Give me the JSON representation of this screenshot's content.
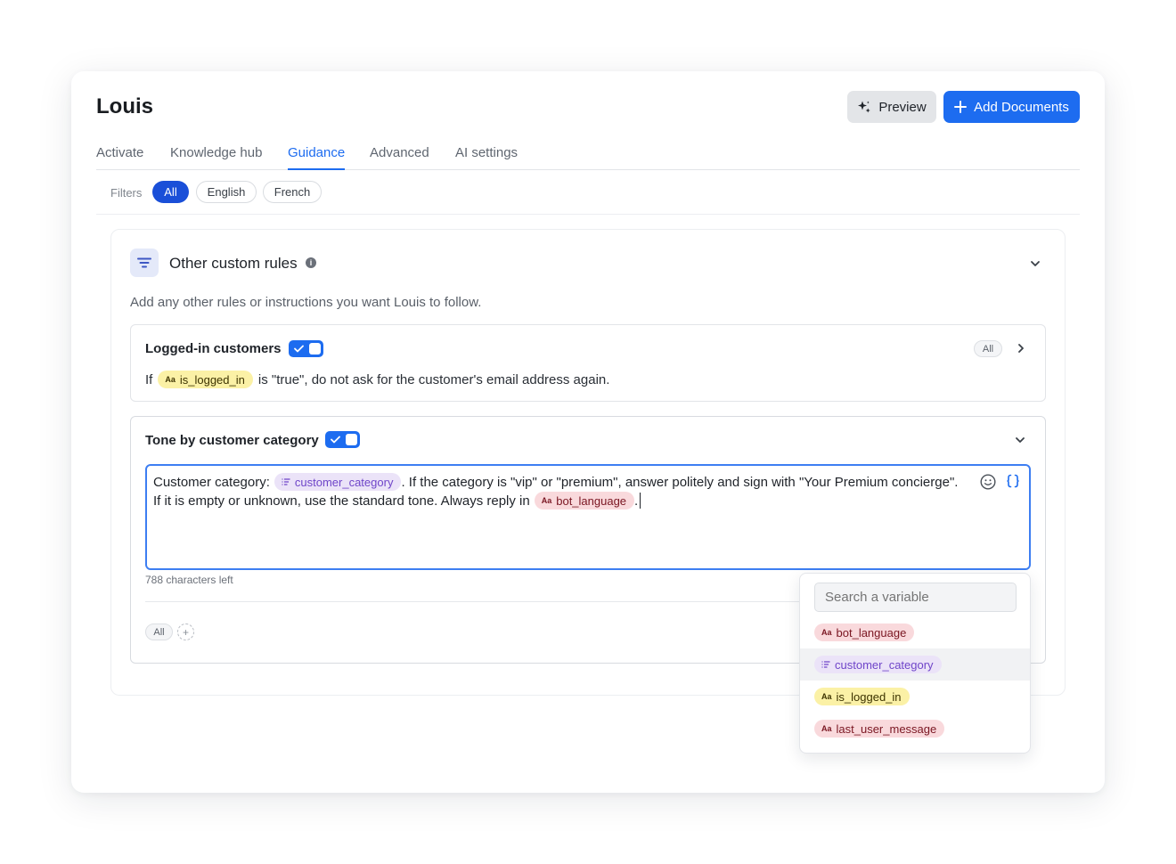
{
  "header": {
    "title": "Louis",
    "preview_label": "Preview",
    "add_documents_label": "Add Documents"
  },
  "tabs": [
    {
      "label": "Activate"
    },
    {
      "label": "Knowledge hub"
    },
    {
      "label": "Guidance"
    },
    {
      "label": "Advanced"
    },
    {
      "label": "AI settings"
    }
  ],
  "active_tab": "Guidance",
  "filters": {
    "label": "Filters",
    "options": [
      "All",
      "English",
      "French"
    ],
    "selected": "All"
  },
  "section": {
    "title": "Other custom rules",
    "description": "Add any other rules or instructions you want Louis to follow."
  },
  "rule1": {
    "name": "Logged-in customers",
    "enabled": true,
    "language_tag": "All",
    "text_prefix": "If",
    "variable": "is_logged_in",
    "text_suffix": "is \"true\", do not ask for the customer's email address again."
  },
  "rule2": {
    "name": "Tone by customer category",
    "enabled": true,
    "line1_prefix": "Customer category:",
    "line1_variable": "customer_category",
    "line1_suffix": ". If the category is \"vip\" or \"premium\", answer politely and sign with \"Your Premium concierge\".",
    "line2_prefix": "If it is empty or unknown, use the standard tone. Always reply in",
    "line2_variable": "bot_language",
    "line2_suffix": ".",
    "chars_left": "788 characters left",
    "language_tag": "All",
    "add_language": "+"
  },
  "variable_picker": {
    "search_placeholder": "Search a variable",
    "items": [
      {
        "name": "bot_language",
        "type_icon": "Aa",
        "color": "#f9d9dc"
      },
      {
        "name": "customer_category",
        "type_icon": "list-icon",
        "color": "#ebe3f8",
        "highlighted": true
      },
      {
        "name": "is_logged_in",
        "type_icon": "Aa",
        "color": "#fbf1a6"
      },
      {
        "name": "last_user_message",
        "type_icon": "Aa",
        "color": "#f9d9dc"
      }
    ]
  },
  "icons": {
    "text_type": "Aa",
    "info": "i"
  },
  "colors": {
    "accent": "#1d6cf0",
    "filter_selected": "#1a4fd8"
  }
}
